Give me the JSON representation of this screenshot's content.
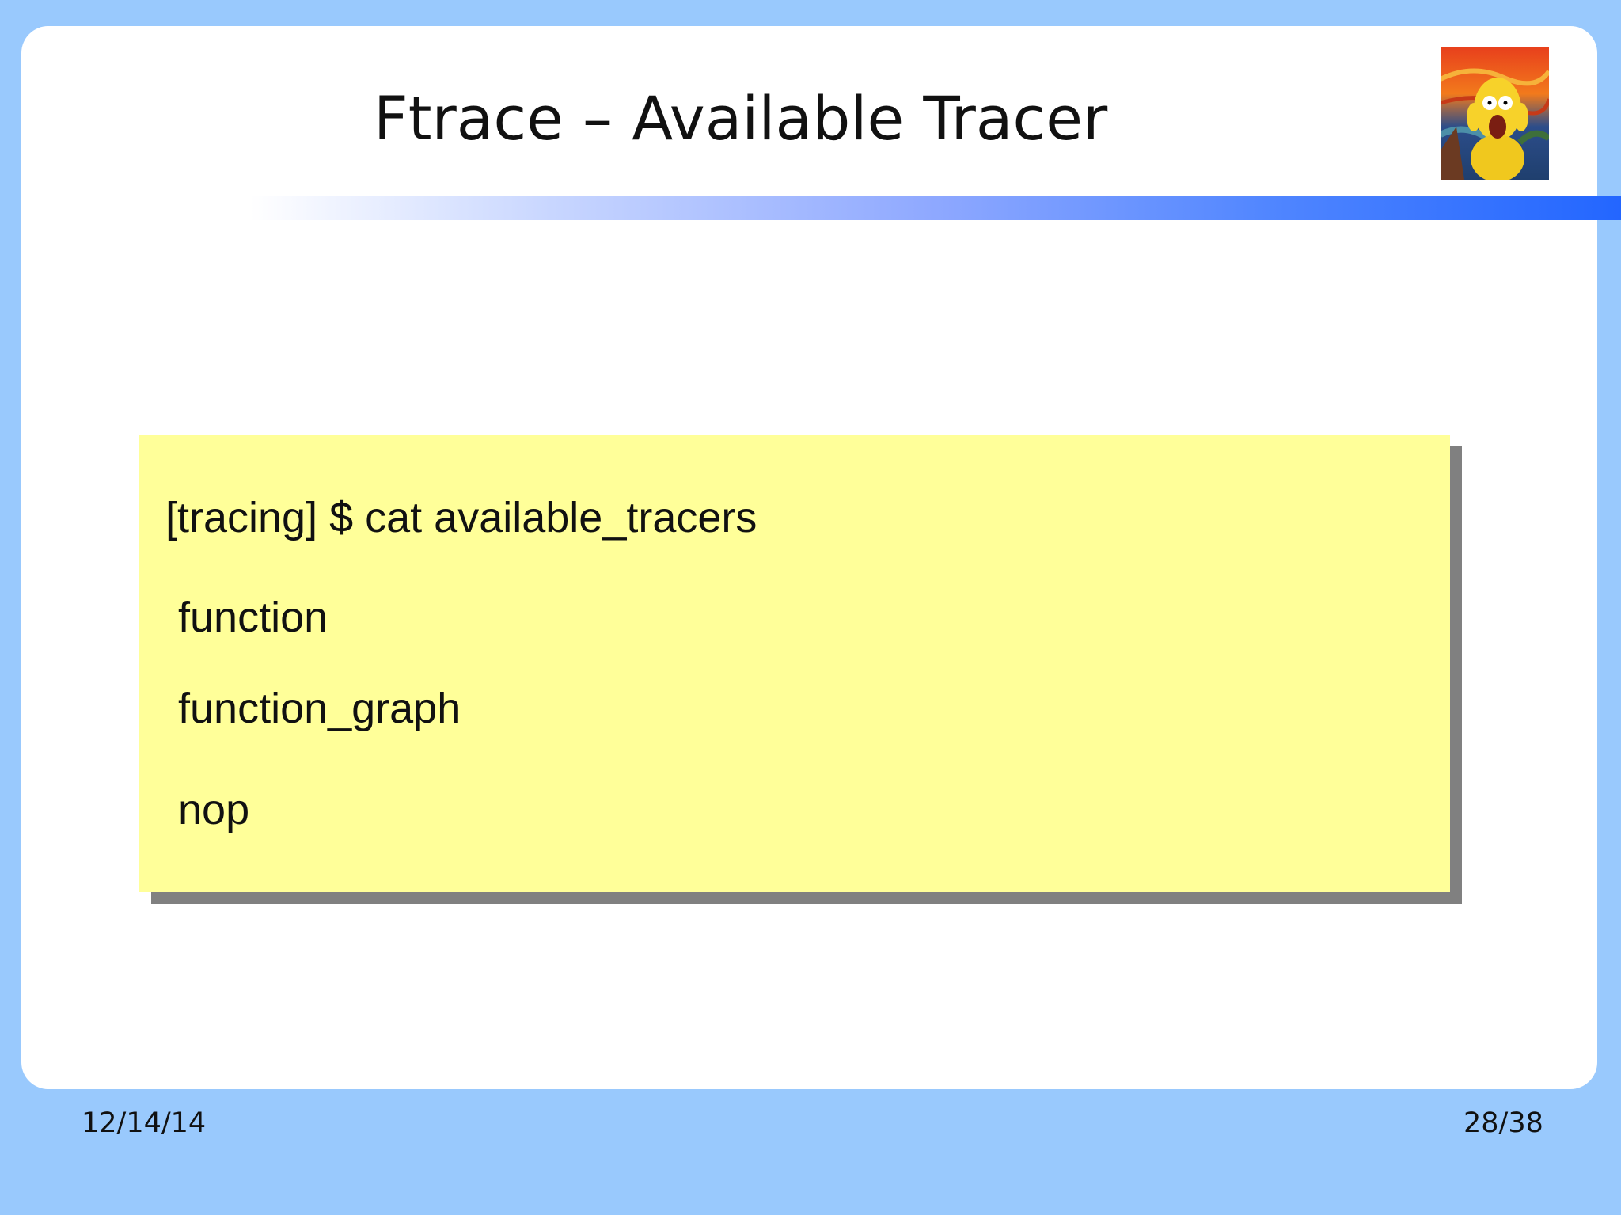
{
  "slide": {
    "title": "Ftrace – Available Tracer",
    "code_lines": [
      "[tracing] $ cat available_tracers",
      "function",
      "function_graph",
      "nop"
    ]
  },
  "footer": {
    "date": "12/14/14",
    "page": "28/38"
  },
  "colors": {
    "background": "#99c9fd",
    "slide": "#ffffff",
    "code_box": "#ffff99",
    "code_shadow": "#808080",
    "title_bar_end": "#2366ff"
  },
  "icons": {
    "avatar": "cartoon-scream-icon"
  }
}
